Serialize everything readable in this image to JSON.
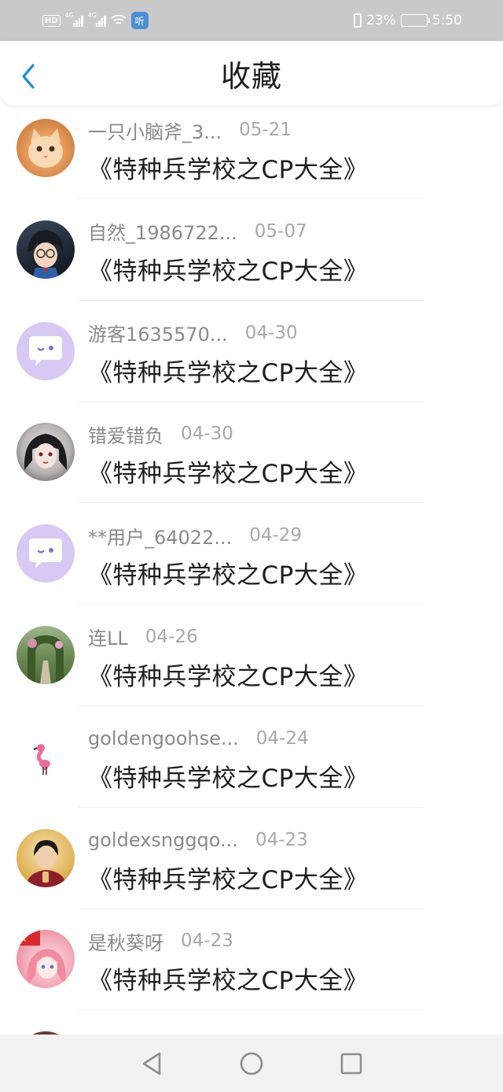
{
  "status_bar": {
    "hd_label": "HD",
    "net1": "4G",
    "net2": "4G",
    "nfc_label": "听",
    "battery_percent": "23%",
    "time": "5:50"
  },
  "header": {
    "title": "收藏",
    "back_icon": "chevron-left-icon",
    "accent_color": "#1e88e5"
  },
  "favorites": [
    {
      "username": "一只小脑斧_3...",
      "date": "05-21",
      "title": "《特种兵学校之CP大全》",
      "avatar": "cat-photo"
    },
    {
      "username": "自然_1986722...",
      "date": "05-07",
      "title": "《特种兵学校之CP大全》",
      "avatar": "anime-detective"
    },
    {
      "username": "游客1635570...",
      "date": "04-30",
      "title": "《特种兵学校之CP大全》",
      "avatar": "default-chat-bubble"
    },
    {
      "username": "错爱错负",
      "date": "04-30",
      "title": "《特种兵学校之CP大全》",
      "avatar": "anime-girl"
    },
    {
      "username": "**用户_64022...",
      "date": "04-29",
      "title": "《特种兵学校之CP大全》",
      "avatar": "default-chat-bubble"
    },
    {
      "username": "连LL",
      "date": "04-26",
      "title": "《特种兵学校之CP大全》",
      "avatar": "garden-arch"
    },
    {
      "username": "goldengoohse...",
      "date": "04-24",
      "title": "《特种兵学校之CP大全》",
      "avatar": "pink-flamingo"
    },
    {
      "username": "goldexsnggqo...",
      "date": "04-23",
      "title": "《特种兵学校之CP大全》",
      "avatar": "boy-photo"
    },
    {
      "username": "是秋葵呀",
      "date": "04-23",
      "title": "《特种兵学校之CP大全》",
      "avatar": "anime-girl-pink"
    }
  ],
  "navigation": {
    "back": "triangle-back-icon",
    "home": "circle-home-icon",
    "recents": "square-recents-icon"
  }
}
